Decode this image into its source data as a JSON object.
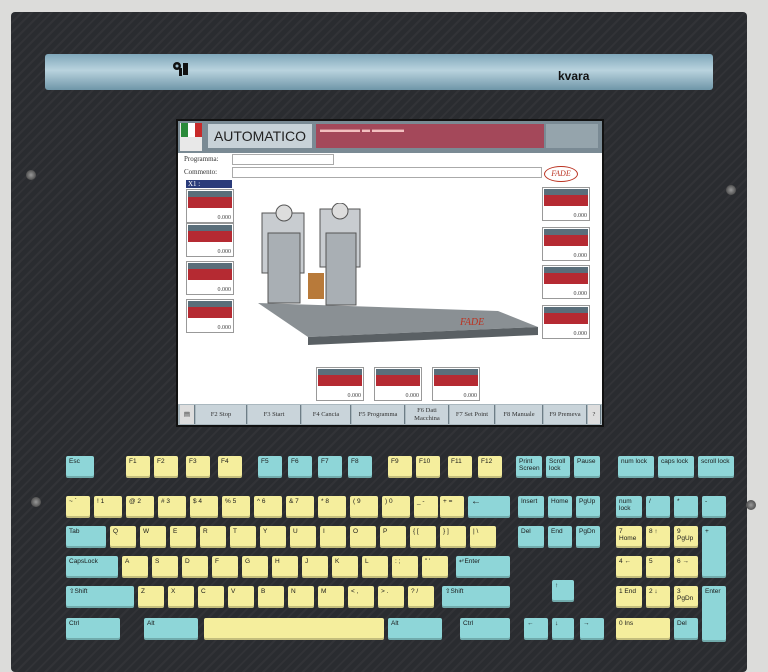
{
  "panel": {
    "brand": "kvara",
    "logo_icon": "key-logo-icon"
  },
  "screen": {
    "mode_title": "AUTOMATICO",
    "field_program_label": "Programma:",
    "field_comment_label": "Commento:",
    "logo_text": "FADE",
    "axis_label": "X1 :",
    "left_gauges": [
      "0.000",
      "0.000",
      "0.000",
      "0.000"
    ],
    "right_gauges": [
      "0.000",
      "0.000",
      "0.000",
      "0.000"
    ],
    "bottom_gauges": [
      "0.000",
      "0.000",
      "0.000"
    ],
    "machine_logo": "FADE",
    "function_keys": [
      "F2 Stop",
      "F3 Start",
      "F4 Cancia",
      "F5 Programma",
      "F6 Dati Macchina",
      "F7 Set Point",
      "F8 Manuale",
      "F9 Premeva"
    ]
  },
  "keyboard": {
    "row1": [
      "Esc",
      "F1",
      "F2",
      "F3",
      "F4",
      "F5",
      "F6",
      "F7",
      "F8",
      "F9",
      "F10",
      "F11",
      "F12",
      "Print Screen",
      "Scroll lock",
      "Pause",
      "num lock",
      "caps lock",
      "scroll lock"
    ],
    "row2": [
      "~ `",
      "! 1",
      "@ 2",
      "# 3",
      "$ 4",
      "% 5",
      "^ 6",
      "& 7",
      "* 8",
      "( 9",
      ") 0",
      "_ -",
      "+ =",
      "←",
      "Insert",
      "Home",
      "PgUp",
      "num lock",
      "/",
      "*",
      "-"
    ],
    "row3": [
      "Tab",
      "Q",
      "W",
      "E",
      "R",
      "T",
      "Y",
      "U",
      "I",
      "O",
      "P",
      "{ [",
      "} ]",
      "| \\",
      "Del",
      "End",
      "PgDn",
      "7 Home",
      "8 ↑",
      "9 PgUp",
      "+"
    ],
    "row4": [
      "CapsLock",
      "A",
      "S",
      "D",
      "F",
      "G",
      "H",
      "J",
      "K",
      "L",
      ": ;",
      "\" '",
      "↵Enter",
      "4 ←",
      "5",
      "6 →"
    ],
    "row5": [
      "⇧Shift",
      "Z",
      "X",
      "C",
      "V",
      "B",
      "N",
      "M",
      "< ,",
      "> .",
      "? /",
      "⇧Shift",
      "↑",
      "1 End",
      "2 ↓",
      "3 PgDn",
      "Enter"
    ],
    "row6": [
      "Ctrl",
      "Alt",
      "",
      "Alt",
      "Ctrl",
      "←",
      "↓",
      "→",
      "0 Ins",
      "Del"
    ]
  }
}
